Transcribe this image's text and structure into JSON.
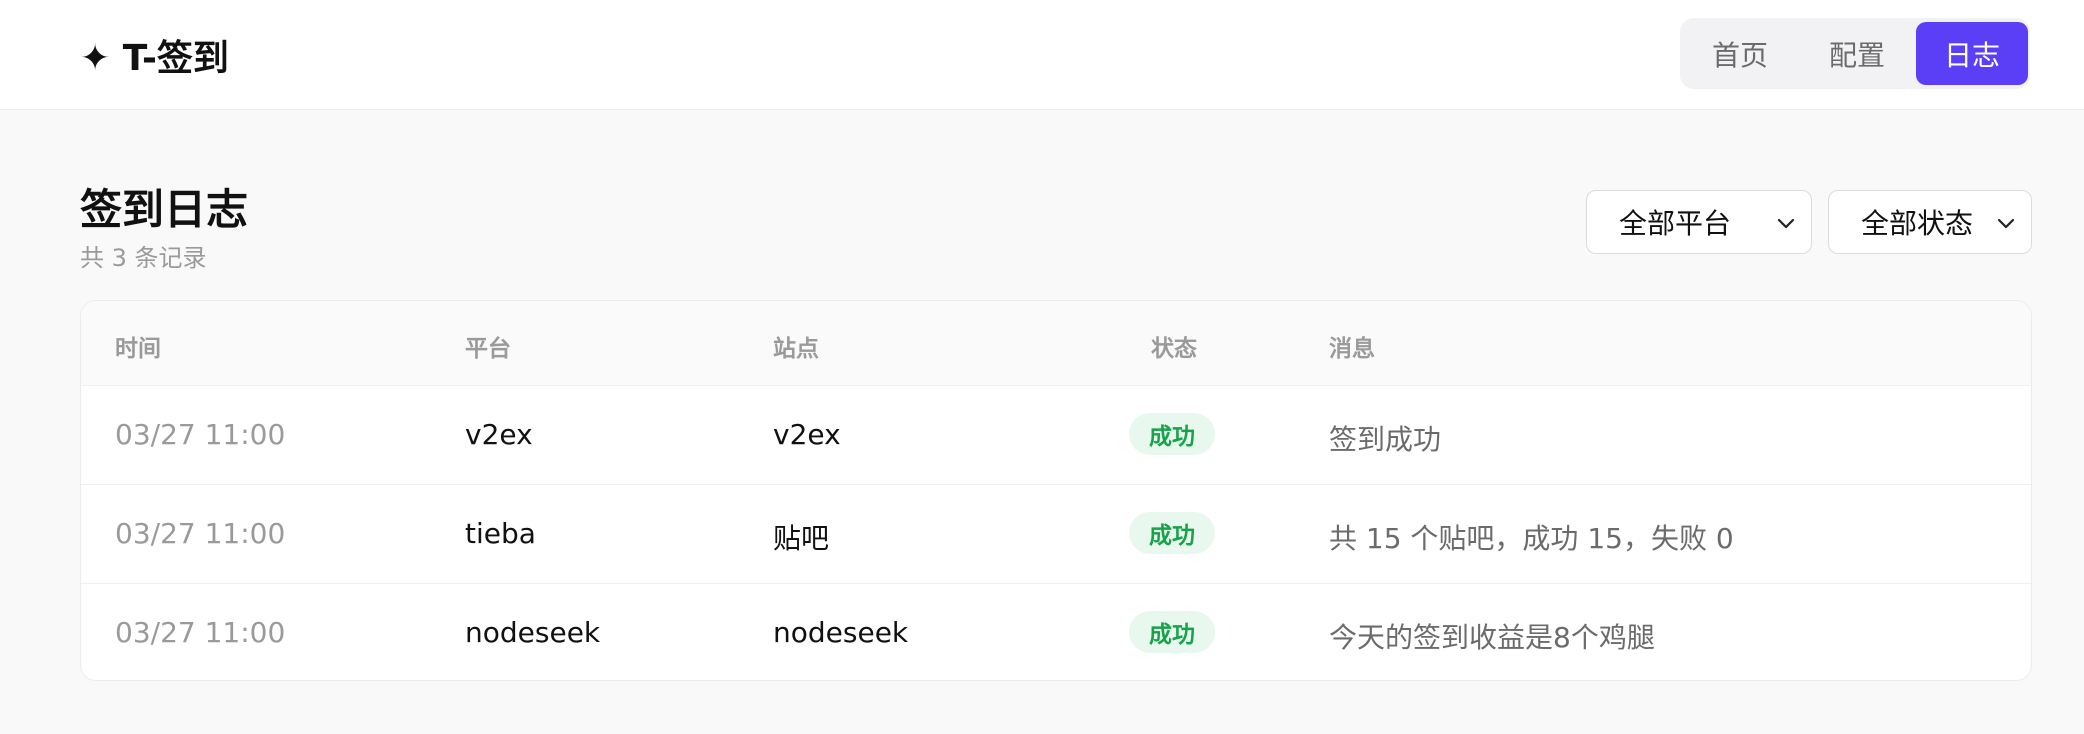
{
  "header": {
    "brand_icon": "sparkle-icon",
    "brand_title": "✦ T-签到",
    "nav": [
      {
        "label": "首页",
        "active": false
      },
      {
        "label": "配置",
        "active": false
      },
      {
        "label": "日志",
        "active": true
      }
    ],
    "accent_color": "#5b3ff7"
  },
  "page": {
    "title": "签到日志",
    "subtitle": "共 3 条记录"
  },
  "filters": {
    "platform": {
      "selected": "全部平台",
      "icon": "chevron-down-icon"
    },
    "status": {
      "selected": "全部状态",
      "icon": "chevron-down-icon"
    }
  },
  "table": {
    "columns": [
      "时间",
      "平台",
      "站点",
      "状态",
      "消息"
    ],
    "rows": [
      {
        "time": "03/27 11:00",
        "platform": "v2ex",
        "site": "v2ex",
        "status": "成功",
        "message": "签到成功"
      },
      {
        "time": "03/27 11:00",
        "platform": "tieba",
        "site": "贴吧",
        "status": "成功",
        "message": "共 15 个贴吧，成功 15，失败 0"
      },
      {
        "time": "03/27 11:00",
        "platform": "nodeseek",
        "site": "nodeseek",
        "status": "成功",
        "message": "今天的签到收益是8个鸡腿"
      }
    ],
    "success_color": "#16a34a"
  }
}
